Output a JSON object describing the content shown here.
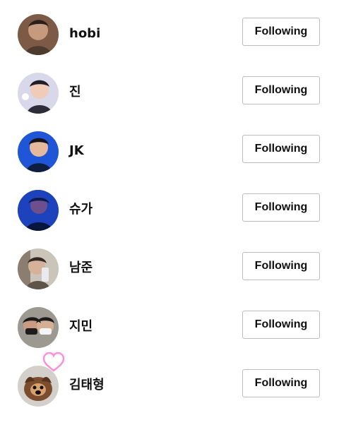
{
  "following_list": {
    "items": [
      {
        "name": "hobi",
        "button": "Following"
      },
      {
        "name": "진",
        "button": "Following"
      },
      {
        "name": "JK",
        "button": "Following"
      },
      {
        "name": "슈가",
        "button": "Following"
      },
      {
        "name": "남준",
        "button": "Following"
      },
      {
        "name": "지민",
        "button": "Following"
      },
      {
        "name": "김태형",
        "button": "Following"
      }
    ]
  },
  "colors": {
    "button_border": "#bdbdbd",
    "text": "#111111",
    "background": "#ffffff",
    "heart": "#ff8fd8"
  }
}
